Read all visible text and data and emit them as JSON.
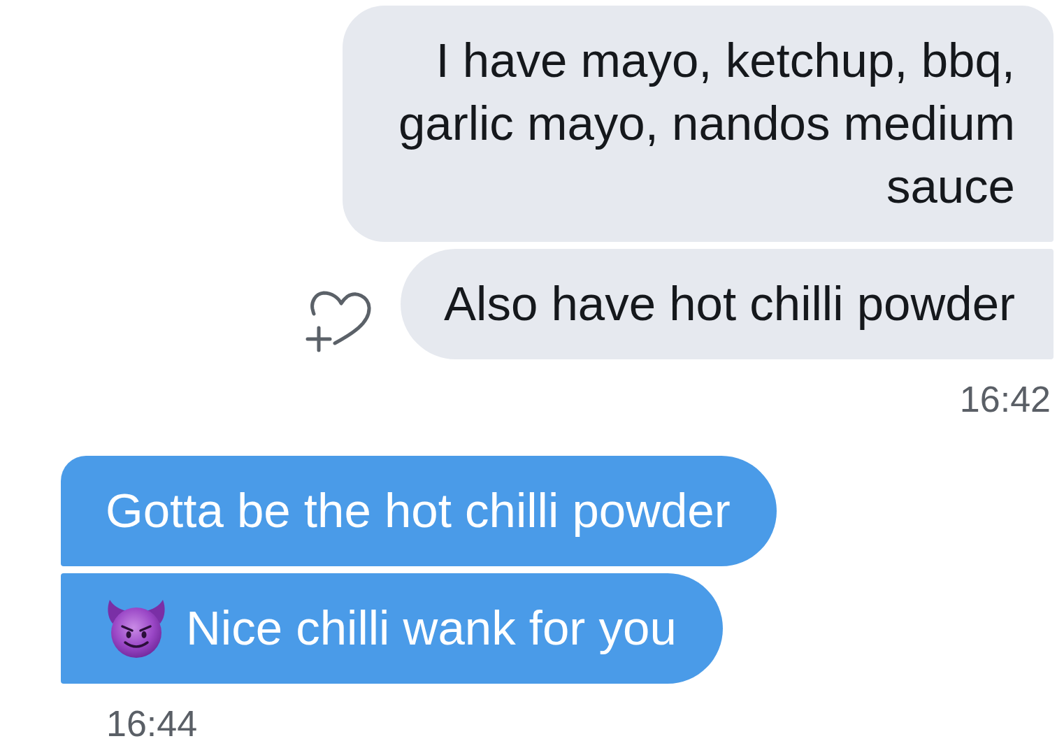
{
  "conversation": [
    {
      "kind": "incoming",
      "bubbles": [
        {
          "kind": "plain",
          "text": "I have mayo, ketchup, bbq, garlic mayo, nandos medium sauce"
        },
        {
          "kind": "with_react",
          "text": "Also have hot chilli powder"
        }
      ],
      "time": "16:42"
    },
    {
      "kind": "outgoing",
      "bubbles": [
        {
          "kind": "plain",
          "text": "Gotta be the hot chilli powder"
        },
        {
          "kind": "with_emoji",
          "text": "Nice chilli wank for you"
        }
      ],
      "time": "16:44"
    }
  ]
}
